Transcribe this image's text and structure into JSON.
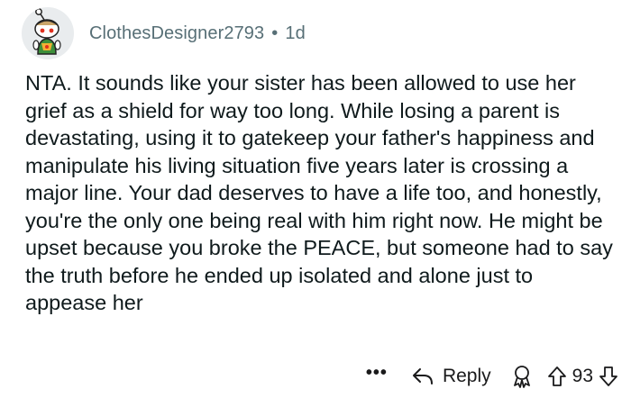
{
  "comment": {
    "username": "ClothesDesigner2793",
    "separator": "•",
    "age": "1d",
    "body": "NTA. It sounds like your sister has been allowed to use her grief as a shield for way too long. While losing a parent is devastating, using it to gatekeep your father's happiness and manipulate his living situation five years later is crossing a major line. Your dad deserves to have a life too, and honestly, you're the only one being real with him right now. He might be upset because you broke the PEACE, but someone had to say the truth before he ended up isolated and alone just to appease her",
    "actions": {
      "more": "•••",
      "reply_label": "Reply",
      "score": "93"
    }
  },
  "icons": {
    "avatar": "snoo-avatar-icon",
    "reply": "reply-arrow-icon",
    "award": "award-icon",
    "upvote": "upvote-arrow-icon",
    "downvote": "downvote-arrow-icon"
  },
  "colors": {
    "meta_text": "#576f76",
    "body_text": "#0f1a1c",
    "avatar_bg": "#e9ecee"
  }
}
